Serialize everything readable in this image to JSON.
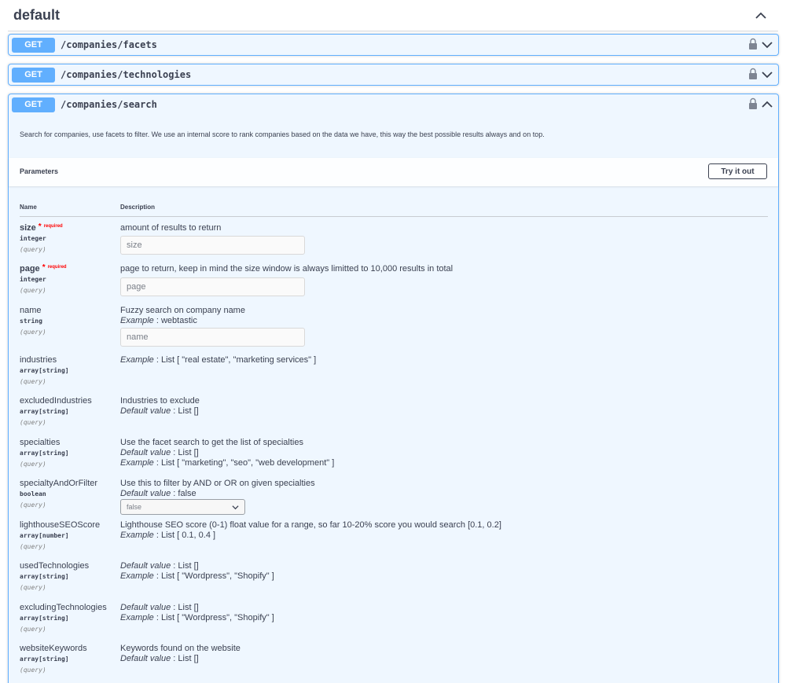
{
  "section": {
    "title": "default"
  },
  "operations": [
    {
      "method": "GET",
      "path": "/companies/facets",
      "expanded": false
    },
    {
      "method": "GET",
      "path": "/companies/technologies",
      "expanded": false
    },
    {
      "method": "GET",
      "path": "/companies/search",
      "expanded": true
    }
  ],
  "search": {
    "description": "Search for companies, use facets to filter. We use an internal score to rank companies based on the data we have, this way the best possible results always and on top.",
    "parameters_title": "Parameters",
    "try_button": "Try it out",
    "col_name": "Name",
    "col_description": "Description",
    "star": "*",
    "required_label": "required",
    "example_label": "Example",
    "default_label": "Default value",
    "colon": " : ",
    "params": [
      {
        "name": "size",
        "type": "integer",
        "in": "(query)",
        "desc": "amount of results to return",
        "placeholder": "size"
      },
      {
        "name": "page",
        "type": "integer",
        "in": "(query)",
        "desc": "page to return, keep in mind the size window is always limitted to 10,000 results in total",
        "placeholder": "page"
      },
      {
        "name": "name",
        "type": "string",
        "in": "(query)",
        "desc": "Fuzzy search on company name",
        "example": "webtastic",
        "placeholder": "name"
      },
      {
        "name": "industries",
        "type": "array[string]",
        "in": "(query)",
        "example": "List [ \"real estate\", \"marketing services\" ]"
      },
      {
        "name": "excludedIndustries",
        "type": "array[string]",
        "in": "(query)",
        "desc": "Industries to exclude",
        "default": "List []"
      },
      {
        "name": "specialties",
        "type": "array[string]",
        "in": "(query)",
        "desc": "Use the facet search to get the list of specialties",
        "default": "List []",
        "example": "List [ \"marketing\", \"seo\", \"web development\" ]"
      },
      {
        "name": "specialtyAndOrFilter",
        "type": "boolean",
        "in": "(query)",
        "desc": "Use this to filter by AND or OR on given specialties",
        "default": "false",
        "select_value": "false"
      },
      {
        "name": "lighthouseSEOScore",
        "type": "array[number]",
        "in": "(query)",
        "desc": "Lighthouse SEO score (0-1) float value for a range, so far 10-20% score you would search [0.1, 0.2]",
        "example": "List [ 0.1, 0.4 ]"
      },
      {
        "name": "usedTechnologies",
        "type": "array[string]",
        "in": "(query)",
        "default": "List []",
        "example": "List [ \"Wordpress\", \"Shopify\" ]"
      },
      {
        "name": "excludingTechnologies",
        "type": "array[string]",
        "in": "(query)",
        "default": "List []",
        "example": "List [ \"Wordpress\", \"Shopify\" ]"
      },
      {
        "name": "websiteKeywords",
        "type": "array[string]",
        "in": "(query)",
        "desc": "Keywords found on the website",
        "default": "List []"
      }
    ]
  },
  "colors": {
    "get": "#61affe",
    "text": "#3b4151",
    "required": "#ff0000"
  },
  "icons": {
    "collapse": "chevron-up-icon",
    "expand": "chevron-down-icon",
    "auth": "lock-icon"
  }
}
